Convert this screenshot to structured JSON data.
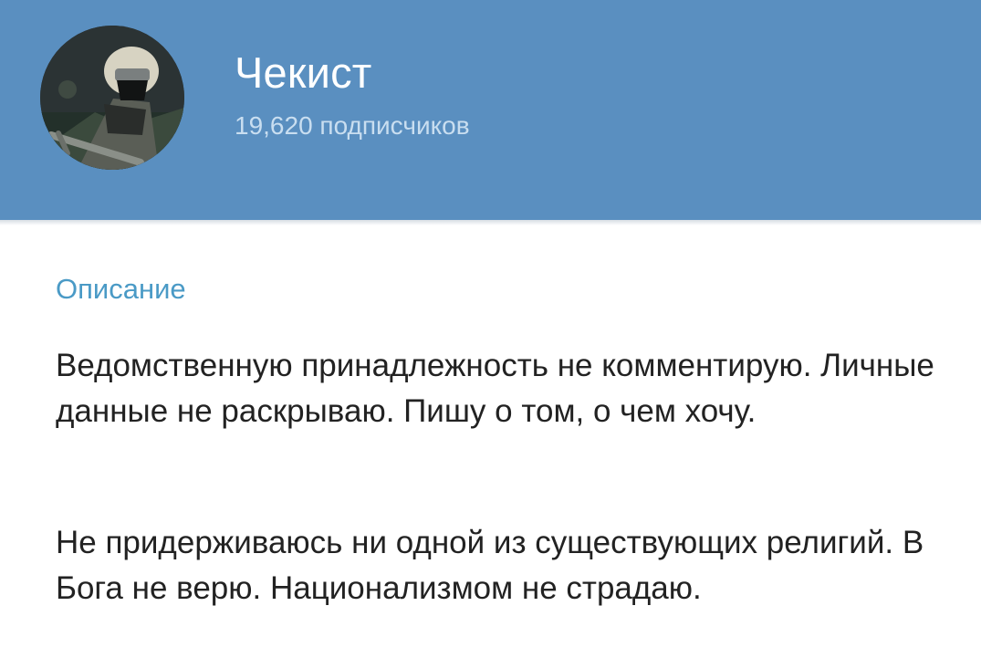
{
  "channel": {
    "name": "Чекист",
    "subscribers": "19,620 подписчиков",
    "avatar_icon": "soldier-avatar-icon"
  },
  "description": {
    "title": "Описание",
    "paragraphs": [
      "Ведомственную принадлежность не комментирую. Личные данные не раскрываю. Пишу о том, о чем хочу.",
      "Не придерживаюсь ни одной из существующих религий. В Бога не верю. Национализмом не страдаю."
    ]
  },
  "colors": {
    "header_background": "#5a8fc0",
    "section_title": "#4a9ac6",
    "text": "#222222"
  }
}
